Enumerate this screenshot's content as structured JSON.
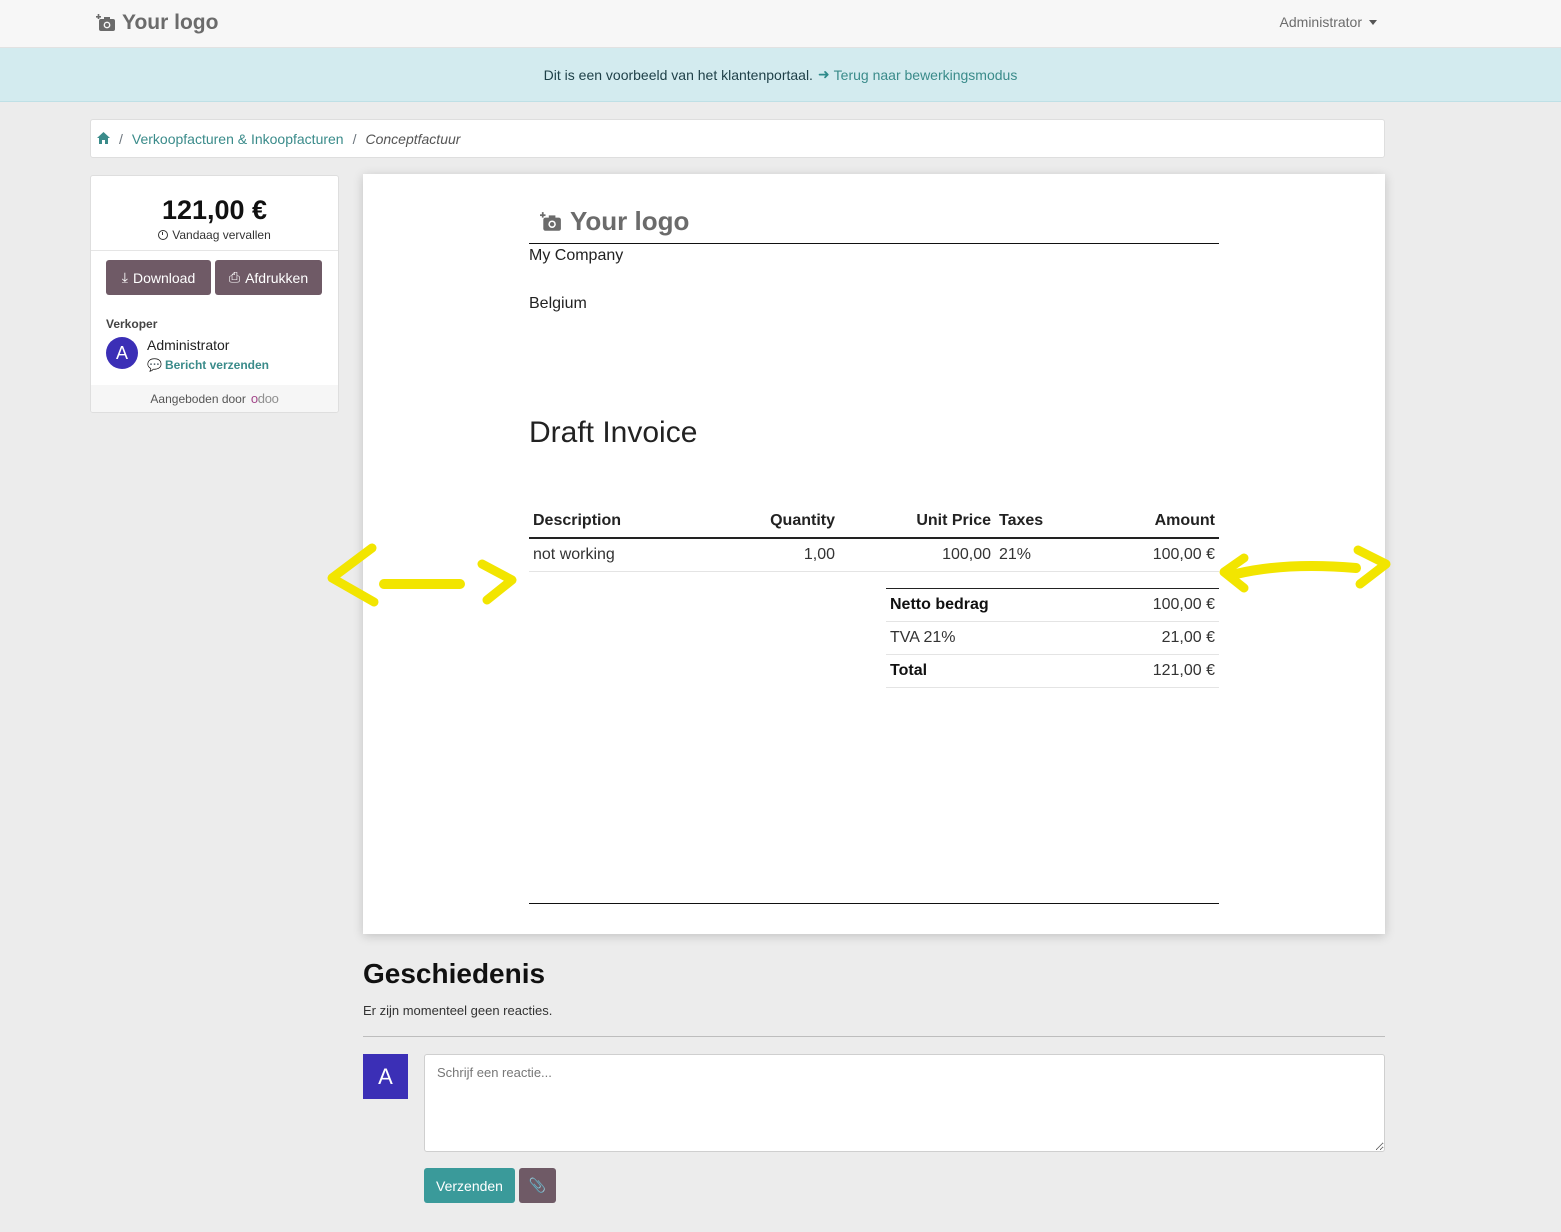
{
  "nav": {
    "logo_text": "Your logo",
    "user_menu": "Administrator"
  },
  "banner": {
    "text": "Dit is een voorbeeld van het klantenportaal.",
    "link": "Terug naar bewerkingsmodus"
  },
  "breadcrumb": {
    "items": [
      "Verkoopfacturen & Inkoopfacturen",
      "Conceptfactuur"
    ]
  },
  "sidebar": {
    "amount": "121,00 €",
    "due_text": "Vandaag vervallen",
    "download_label": "Download",
    "print_label": "Afdrukken",
    "seller_label": "Verkoper",
    "seller_initial": "A",
    "seller_name": "Administrator",
    "send_message": "Bericht verzenden",
    "powered_by": "Aangeboden door"
  },
  "invoice": {
    "logo_text": "Your logo",
    "company": "My Company",
    "country": "Belgium",
    "title": "Draft Invoice",
    "columns": [
      "Description",
      "Quantity",
      "Unit Price",
      "Taxes",
      "Amount"
    ],
    "lines": [
      {
        "description": "not working",
        "quantity": "1,00",
        "unit_price": "100,00",
        "taxes": "21%",
        "amount": "100,00 €"
      }
    ],
    "totals": [
      {
        "label": "Netto bedrag",
        "value": "100,00 €"
      },
      {
        "label": "TVA 21%",
        "value": "21,00 €"
      },
      {
        "label": "Total",
        "value": "121,00 €"
      }
    ]
  },
  "history": {
    "title": "Geschiedenis",
    "empty_text": "Er zijn momenteel geen reacties.",
    "avatar_initial": "A",
    "comment_placeholder": "Schrijf een reactie...",
    "send_label": "Verzenden"
  },
  "colors": {
    "accent": "#3a8b8a",
    "button_dark": "#6f5a66",
    "avatar": "#3b2fb6",
    "annotation": "#f2e500"
  }
}
